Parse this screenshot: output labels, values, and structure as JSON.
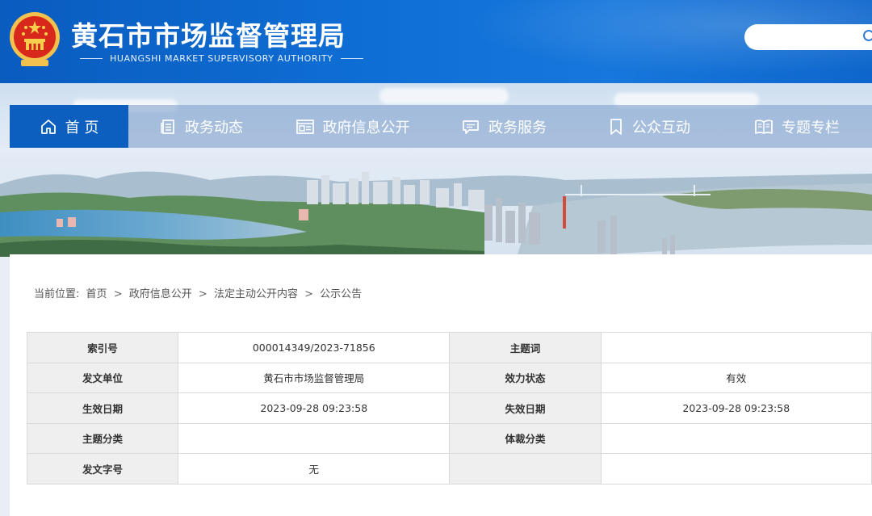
{
  "header": {
    "title": "黄石市市场监督管理局",
    "subtitle": "HUANGSHI MARKET SUPERVISORY AUTHORITY",
    "search_placeholder": ""
  },
  "nav": {
    "items": [
      {
        "label": "首 页",
        "icon": "home-icon",
        "active": true
      },
      {
        "label": "政务动态",
        "icon": "document-list-icon",
        "active": false
      },
      {
        "label": "政府信息公开",
        "icon": "info-board-icon",
        "active": false
      },
      {
        "label": "政务服务",
        "icon": "chat-service-icon",
        "active": false
      },
      {
        "label": "公众互动",
        "icon": "bookmark-icon",
        "active": false
      },
      {
        "label": "专题专栏",
        "icon": "book-icon",
        "active": false
      }
    ]
  },
  "breadcrumb": {
    "prefix": "当前位置:",
    "items": [
      "首页",
      "政府信息公开",
      "法定主动公开内容",
      "公示公告"
    ],
    "separator": ">"
  },
  "meta_table": {
    "rows": [
      {
        "k1": "索引号",
        "v1": "000014349/2023-71856",
        "k2": "主题词",
        "v2": ""
      },
      {
        "k1": "发文单位",
        "v1": "黄石市市场监督管理局",
        "k2": "效力状态",
        "v2": "有效"
      },
      {
        "k1": "生效日期",
        "v1": "2023-09-28 09:23:58",
        "k2": "失效日期",
        "v2": "2023-09-28 09:23:58"
      },
      {
        "k1": "主题分类",
        "v1": "",
        "k2": "体裁分类",
        "v2": ""
      },
      {
        "k1": "发文字号",
        "v1": "无",
        "k2": "",
        "v2": ""
      }
    ]
  },
  "colors": {
    "header_blue": "#0f6fd6",
    "nav_active": "#0d5fbf"
  }
}
